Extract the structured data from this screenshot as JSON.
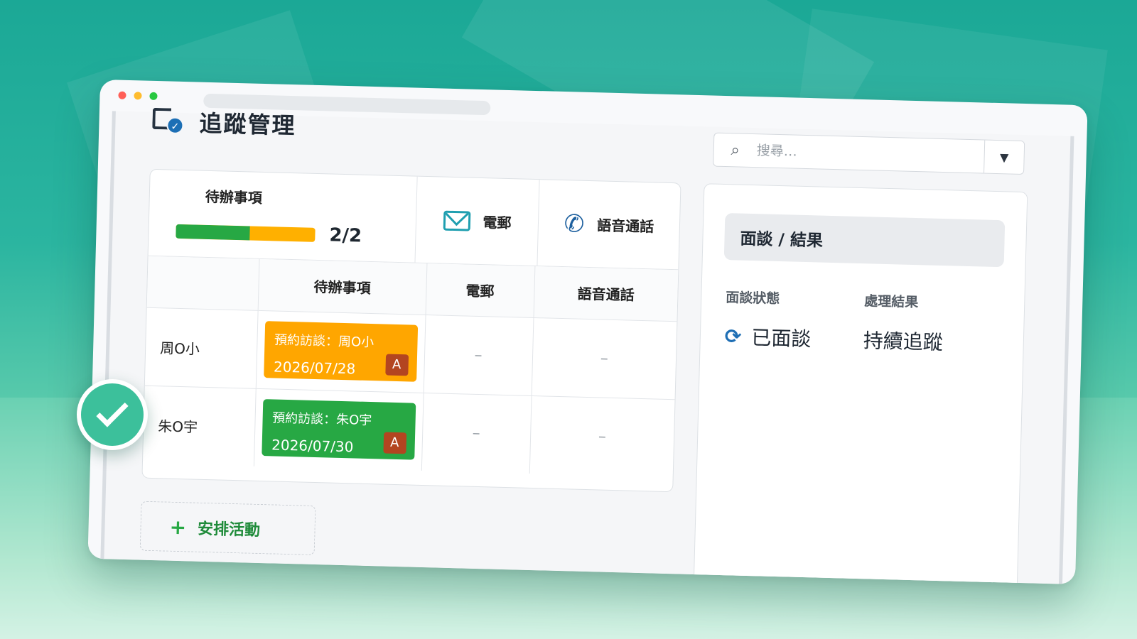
{
  "colors": {
    "accent_green": "#27a844",
    "accent_orange": "#ffa600",
    "badge_brown": "#b34520",
    "icon_blue": "#1c5f9e",
    "background_teal": "#1ba896"
  },
  "page": {
    "title": "追蹤管理"
  },
  "search": {
    "placeholder": "搜尋…"
  },
  "summary": {
    "todo_label": "待辦事項",
    "todo_progress_text": "2/2",
    "todo_progress_green_fraction": 0.53,
    "email_label": "電郵",
    "call_label": "語音通話"
  },
  "table": {
    "headers": [
      "",
      "待辦事項",
      "電郵",
      "語音通話"
    ],
    "rows": [
      {
        "name": "周O小",
        "task_title": "預約訪談：周O小",
        "task_date": "2026/07/28",
        "task_badge": "A",
        "task_color": "orange",
        "email": "–",
        "call": "–"
      },
      {
        "name": "朱O宇",
        "task_title": "預約訪談：朱O宇",
        "task_date": "2026/07/30",
        "task_badge": "A",
        "task_color": "green",
        "email": "–",
        "call": "–"
      }
    ]
  },
  "add_activity": {
    "label": "安排活動"
  },
  "panel": {
    "title": "面談 / 結果",
    "status_label": "面談狀態",
    "status_value": "已面談",
    "result_label": "處理結果",
    "result_value": "持續追蹤"
  }
}
